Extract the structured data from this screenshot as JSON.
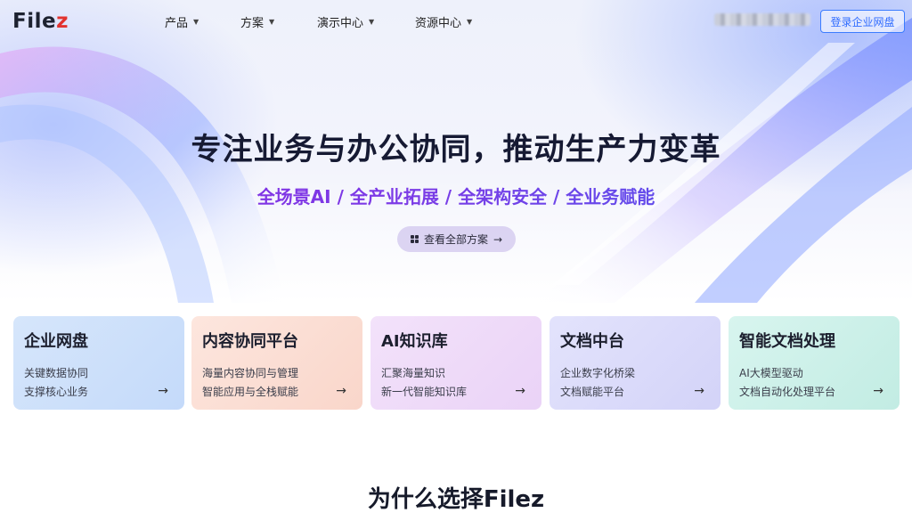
{
  "header": {
    "logo_main": "File",
    "logo_z": "z",
    "nav": [
      {
        "label": "产品"
      },
      {
        "label": "方案"
      },
      {
        "label": "演示中心"
      },
      {
        "label": "资源中心"
      }
    ],
    "login_label": "登录企业网盘"
  },
  "hero": {
    "title": "专注业务与办公协同，推动生产力变革",
    "subtitle": "全场景AI / 全产业拓展 / 全架构安全 / 全业务赋能",
    "cta_label": "查看全部方案"
  },
  "cards": [
    {
      "title": "企业网盘",
      "line1": "关键数据协同",
      "line2": "支撑核心业务"
    },
    {
      "title": "内容协同平台",
      "line1": "海量内容协同与管理",
      "line2": "智能应用与全栈赋能"
    },
    {
      "title": "AI知识库",
      "line1": "汇聚海量知识",
      "line2": "新一代智能知识库"
    },
    {
      "title": "文档中台",
      "line1": "企业数字化桥梁",
      "line2": "文档赋能平台"
    },
    {
      "title": "智能文档处理",
      "line1": "AI大模型驱动",
      "line2": "文档自动化处理平台"
    }
  ],
  "section": {
    "title": "为什么选择Filez"
  },
  "colors": {
    "accent": "#2f6bff",
    "title_dark": "#161a33",
    "subtitle_gradient_start": "#8a2be2",
    "subtitle_gradient_end": "#4a5cf0",
    "logo_z": "#e2332f",
    "card_1": "#cfe2fb",
    "card_2": "#fbe0d6",
    "card_3": "#efdcf8",
    "card_4": "#dcdcfb",
    "card_5": "#cdf1ea"
  },
  "icons": {
    "nav_caret": "caret-down-icon",
    "cta": "grid-icon",
    "card_arrow": "arrow-right-icon"
  }
}
